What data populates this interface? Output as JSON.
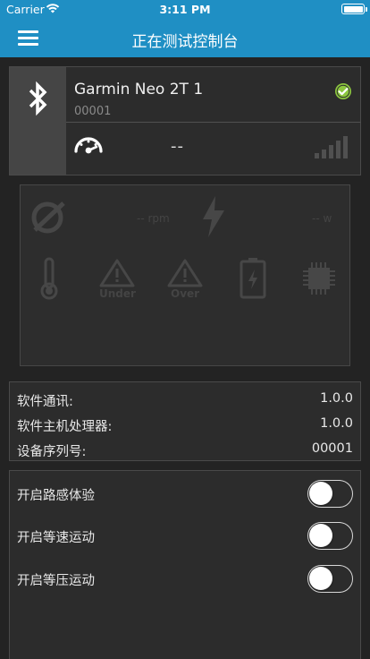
{
  "status_bar": {
    "carrier": "Carrier",
    "time": "3:11 PM"
  },
  "header": {
    "title": "正在测试控制台",
    "color": "#1f8fc4"
  },
  "device": {
    "name": "Garmin Neo 2T 1",
    "serial": "00001",
    "speed_value": "--",
    "connected_icon": "check-circle-icon",
    "connected_color": "#8cc63f"
  },
  "stats": {
    "cadence_value": "-- rpm",
    "power_value": "-- w",
    "under_label": "Under",
    "over_label": "Over"
  },
  "info": {
    "rows": [
      {
        "label": "软件通讯:",
        "value": "1.0.0"
      },
      {
        "label": "软件主机处理器:",
        "value": "1.0.0"
      },
      {
        "label": "设备序列号:",
        "value": "00001"
      }
    ]
  },
  "toggles": {
    "rows": [
      {
        "label": "开启路感体验",
        "on": false
      },
      {
        "label": "开启等速运动",
        "on": false
      },
      {
        "label": "开启等压运动",
        "on": false
      }
    ]
  }
}
